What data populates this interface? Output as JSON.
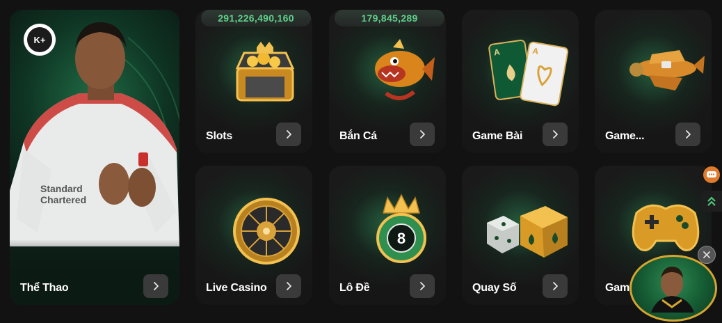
{
  "hero": {
    "label": "Thể Thao",
    "logo_text": "K+",
    "icon": "arrow-right-icon"
  },
  "tiles": [
    {
      "label": "Slots",
      "jackpot": "291,226,490,160",
      "icon": "treasure-chest-icon"
    },
    {
      "label": "Bắn Cá",
      "jackpot": "179,845,289",
      "icon": "fish-icon"
    },
    {
      "label": "Game Bài",
      "icon": "playing-cards-icon"
    },
    {
      "label": "Game...",
      "icon": "airplane-icon"
    },
    {
      "label": "Live Casino",
      "icon": "roulette-icon"
    },
    {
      "label": "Lô Đề",
      "icon": "lottery-ball-icon"
    },
    {
      "label": "Quay Số",
      "icon": "dice-icon"
    },
    {
      "label": "Gam",
      "icon": "gamepad-icon"
    }
  ],
  "side_icons": [
    "chat-support-icon",
    "scroll-top-icon"
  ],
  "promo": {
    "icon": "promo-avatar-icon",
    "close_icon": "close-icon"
  },
  "colors": {
    "background": "#121212",
    "jackpot_text": "#5fd08a",
    "accent_gold": "#d4a52e",
    "card_glow": "#2e965c"
  }
}
